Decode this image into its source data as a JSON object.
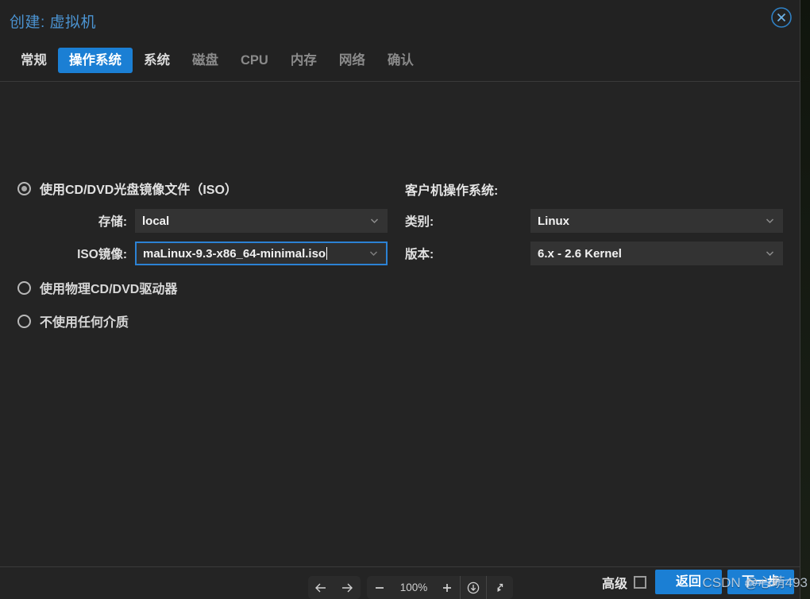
{
  "dialog": {
    "title": "创建: 虚拟机",
    "close_icon": "close-circle-icon"
  },
  "tabs": [
    {
      "label": "常规",
      "state": "enabled"
    },
    {
      "label": "操作系统",
      "state": "active"
    },
    {
      "label": "系统",
      "state": "enabled"
    },
    {
      "label": "磁盘",
      "state": "disabled"
    },
    {
      "label": "CPU",
      "state": "disabled"
    },
    {
      "label": "内存",
      "state": "disabled"
    },
    {
      "label": "网络",
      "state": "disabled"
    },
    {
      "label": "确认",
      "state": "disabled"
    }
  ],
  "media": {
    "option_iso": "使用CD/DVD光盘镜像文件（ISO）",
    "option_physical": "使用物理CD/DVD驱动器",
    "option_none": "不使用任何介质",
    "storage_label": "存储:",
    "storage_value": "local",
    "iso_label": "ISO镜像:",
    "iso_value": "maLinux-9.3-x86_64-minimal.iso"
  },
  "guest": {
    "header": "客户机操作系统:",
    "type_label": "类别:",
    "type_value": "Linux",
    "version_label": "版本:",
    "version_value": "6.x - 2.6 Kernel"
  },
  "footer": {
    "advanced_label": "高级",
    "back_label": "返回",
    "next_label": "下一步"
  },
  "zoom_toolbar": {
    "back_icon": "arrow-left-icon",
    "forward_icon": "arrow-right-icon",
    "zoom_out_icon": "minus-icon",
    "zoom_level": "100%",
    "zoom_in_icon": "plus-icon",
    "download_icon": "download-circle-icon",
    "fit_icon": "fit-screen-icon"
  },
  "watermark": {
    "text": "CSDN @心萌493"
  },
  "colors": {
    "accent_blue": "#1b7fd4",
    "title_blue": "#4b93d1",
    "dialog_bg": "#222222",
    "body_bg": "#242424",
    "field_bg": "#333333"
  }
}
